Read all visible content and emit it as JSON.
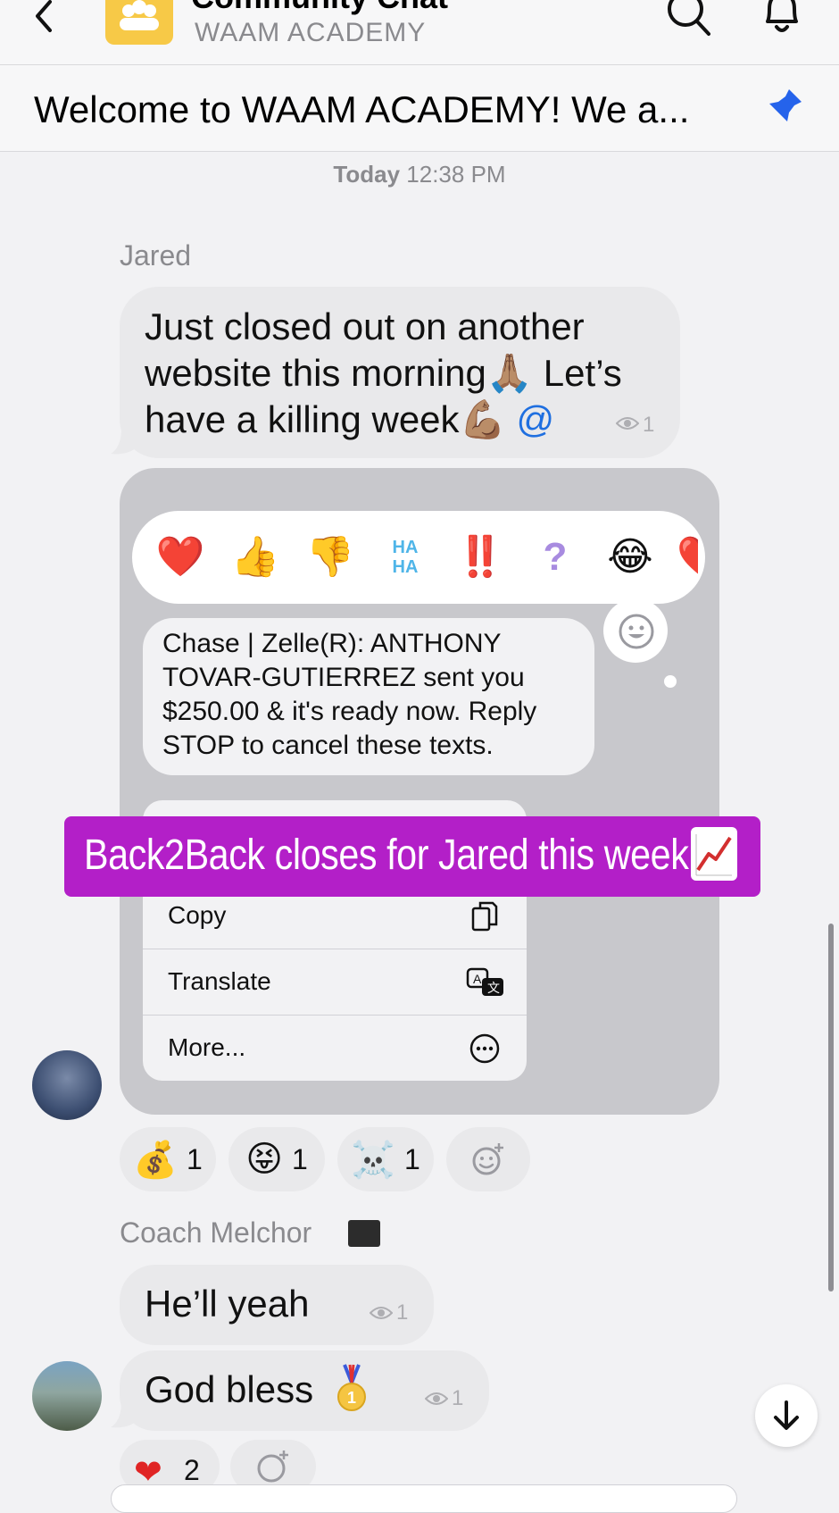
{
  "header": {
    "title": "Community Chat",
    "subtitle": "WAAM ACADEMY"
  },
  "pinned": {
    "text": "Welcome to WAAM ACADEMY! We a..."
  },
  "timestamp": {
    "day": "Today",
    "time": "12:38 PM"
  },
  "messages": [
    {
      "sender": "Jared",
      "text": "Just closed out on another website this morning🙏🏽 Let’s have a killing week💪🏽",
      "mention": "@",
      "seen_count": "1"
    }
  ],
  "context_menu": {
    "reactions": [
      "❤️",
      "👍",
      "👎",
      "HA HA",
      "‼️",
      "?",
      "😂"
    ],
    "shared_message": "Chase | Zelle(R): ANTHONY TOVAR-GUTIERREZ sent you $250.00 & it's ready now. Reply STOP to cancel these texts.",
    "items": [
      {
        "label": "Copy",
        "icon": "copy-icon"
      },
      {
        "label": "Translate",
        "icon": "translate-icon"
      },
      {
        "label": "More...",
        "icon": "more-icon"
      }
    ]
  },
  "story_banner": {
    "text": "Back2Back closes for Jared this week",
    "emoji": "📈"
  },
  "reactions_row": [
    {
      "emoji": "💰",
      "count": "1"
    },
    {
      "emoji": "😝",
      "count": "1"
    },
    {
      "emoji": "☠️",
      "count": "1"
    }
  ],
  "coach": {
    "sender": "Coach Melchor",
    "messages": [
      {
        "text": "He’ll yeah",
        "seen_count": "1"
      },
      {
        "text": "God bless",
        "seen_count": "1"
      }
    ],
    "bottom_reaction_count": "2"
  },
  "colors": {
    "banner": "#b31fc8",
    "mention": "#1f6fe0",
    "pin": "#2563eb",
    "bubble": "#e9e9eb"
  }
}
